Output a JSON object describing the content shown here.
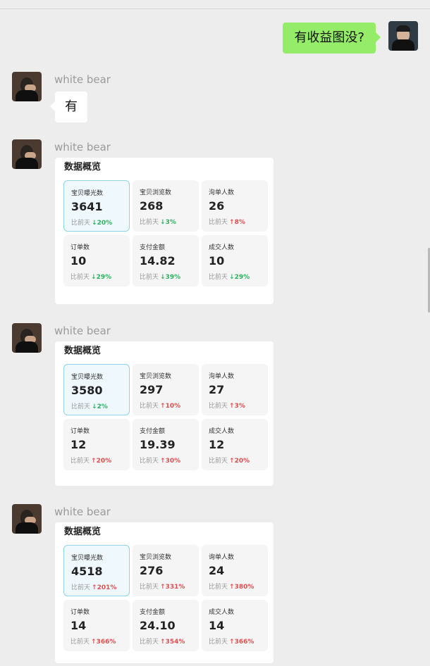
{
  "chat": {
    "self_message": "有收益图没?",
    "messages": [
      {
        "sender": "white bear",
        "text": "有"
      },
      {
        "sender": "white bear",
        "card": {
          "title": "数据概览",
          "metrics": [
            {
              "label": "宝贝曝光数",
              "value": "3641",
              "compare": "比前天",
              "delta": "20%",
              "dir": "down",
              "highlight": true
            },
            {
              "label": "宝贝浏览数",
              "value": "268",
              "compare": "比前天",
              "delta": "3%",
              "dir": "down",
              "highlight": false
            },
            {
              "label": "洵单人数",
              "value": "26",
              "compare": "比前天",
              "delta": "8%",
              "dir": "up",
              "highlight": false
            },
            {
              "label": "订单数",
              "value": "10",
              "compare": "比前天",
              "delta": "29%",
              "dir": "down",
              "highlight": false
            },
            {
              "label": "支付金额",
              "value": "14.82",
              "compare": "比前天",
              "delta": "39%",
              "dir": "down",
              "highlight": false
            },
            {
              "label": "成交人数",
              "value": "10",
              "compare": "比前天",
              "delta": "29%",
              "dir": "down",
              "highlight": false
            }
          ]
        }
      },
      {
        "sender": "white bear",
        "card": {
          "title": "数据概览",
          "metrics": [
            {
              "label": "宝贝曝光数",
              "value": "3580",
              "compare": "比前天",
              "delta": "2%",
              "dir": "down",
              "highlight": true
            },
            {
              "label": "宝贝浏览数",
              "value": "297",
              "compare": "比前天",
              "delta": "10%",
              "dir": "up",
              "highlight": false
            },
            {
              "label": "洵单人数",
              "value": "27",
              "compare": "比前天",
              "delta": "3%",
              "dir": "up",
              "highlight": false
            },
            {
              "label": "订单数",
              "value": "12",
              "compare": "比前天",
              "delta": "20%",
              "dir": "up",
              "highlight": false
            },
            {
              "label": "支付金额",
              "value": "19.39",
              "compare": "比前天",
              "delta": "30%",
              "dir": "up",
              "highlight": false
            },
            {
              "label": "成交人数",
              "value": "12",
              "compare": "比前天",
              "delta": "20%",
              "dir": "up",
              "highlight": false
            }
          ]
        }
      },
      {
        "sender": "white bear",
        "card": {
          "title": "数据概览",
          "metrics": [
            {
              "label": "宝贝曝光数",
              "value": "4518",
              "compare": "比前天",
              "delta": "201%",
              "dir": "up",
              "highlight": true
            },
            {
              "label": "宝贝浏览数",
              "value": "276",
              "compare": "比前天",
              "delta": "331%",
              "dir": "up",
              "highlight": false
            },
            {
              "label": "询单人数",
              "value": "24",
              "compare": "比前天",
              "delta": "380%",
              "dir": "up",
              "highlight": false
            },
            {
              "label": "订单数",
              "value": "14",
              "compare": "比前天",
              "delta": "366%",
              "dir": "up",
              "highlight": false
            },
            {
              "label": "支付金额",
              "value": "24.10",
              "compare": "比前天",
              "delta": "354%",
              "dir": "up",
              "highlight": false
            },
            {
              "label": "成交人数",
              "value": "14",
              "compare": "比前天",
              "delta": "366%",
              "dir": "up",
              "highlight": false
            }
          ]
        }
      }
    ],
    "colors": {
      "self_bubble": "#95ec69",
      "down": "#2db35e",
      "up": "#e04f4f"
    },
    "icons": {
      "up": "↑",
      "down": "↓"
    }
  }
}
